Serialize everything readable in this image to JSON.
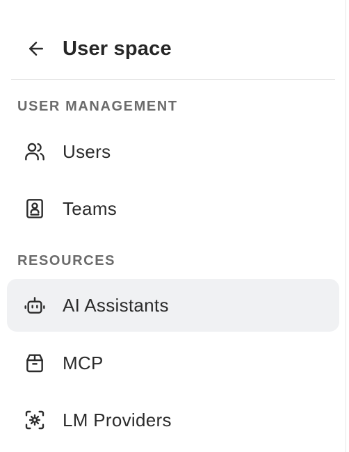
{
  "header": {
    "title": "User space",
    "back_icon": "arrow-left-icon"
  },
  "sections": [
    {
      "label": "USER MANAGEMENT",
      "items": [
        {
          "label": "Users",
          "icon": "users-icon",
          "active": false
        },
        {
          "label": "Teams",
          "icon": "contact-book-icon",
          "active": false
        }
      ]
    },
    {
      "label": "RESOURCES",
      "items": [
        {
          "label": "AI Assistants",
          "icon": "bot-icon",
          "active": true
        },
        {
          "label": "MCP",
          "icon": "toolbox-icon",
          "active": false
        },
        {
          "label": "LM Providers",
          "icon": "server-cog-icon",
          "active": false
        }
      ]
    }
  ],
  "colors": {
    "active_bg": "#f0f1f3",
    "text": "#2b2b2b",
    "section_label": "#6b6b6b",
    "divider": "#e3e3e3"
  }
}
